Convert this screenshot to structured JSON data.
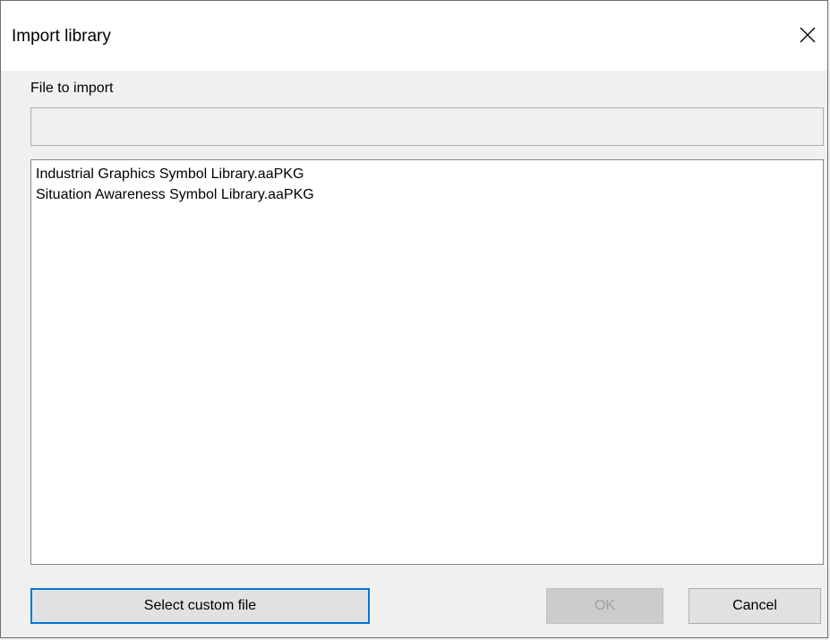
{
  "window": {
    "title": "Import library",
    "close_icon": "close-icon"
  },
  "file_to_import": {
    "label": "File to import",
    "value": ""
  },
  "library_list": {
    "items": [
      "Industrial Graphics Symbol Library.aaPKG",
      "Situation Awareness Symbol Library.aaPKG"
    ]
  },
  "buttons": {
    "select_custom_file": "Select custom file",
    "ok": "OK",
    "cancel": "Cancel"
  },
  "colors": {
    "focus_border": "#0078d7",
    "dialog_background": "#f0f0f0",
    "disabled_text": "#a0a0a0"
  }
}
